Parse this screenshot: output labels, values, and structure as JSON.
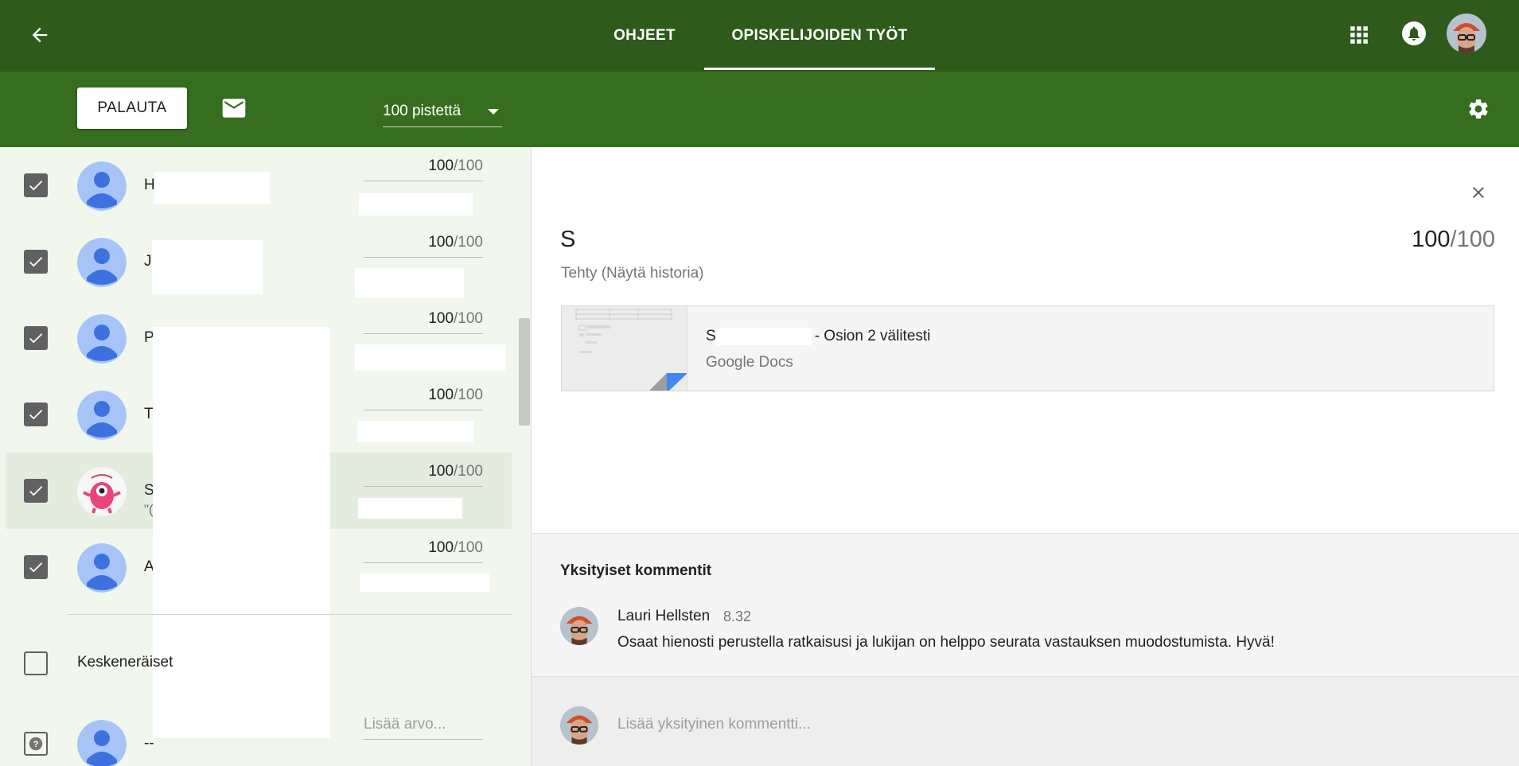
{
  "header": {
    "tabs": [
      {
        "label": "OHJEET",
        "active": false
      },
      {
        "label": "OPISKELIJOIDEN TYÖT",
        "active": true
      }
    ]
  },
  "toolbar": {
    "return_label": "PALAUTA",
    "points_value": "100 pistettä"
  },
  "students": [
    {
      "name": "H",
      "subtitle": "",
      "points": "100",
      "total": "/100",
      "checked": true,
      "avatar": "default"
    },
    {
      "name": "J",
      "subtitle": "",
      "points": "100",
      "total": "/100",
      "checked": true,
      "avatar": "default"
    },
    {
      "name": "P",
      "subtitle": "",
      "points": "100",
      "total": "/100",
      "checked": true,
      "avatar": "default"
    },
    {
      "name": "T",
      "subtitle": "",
      "points": "100",
      "total": "/100",
      "checked": true,
      "avatar": "default"
    },
    {
      "name": "S",
      "subtitle": "\"(",
      "points": "100",
      "total": "/100",
      "checked": true,
      "avatar": "pink-monster",
      "selected": true
    },
    {
      "name": "A",
      "subtitle": "",
      "points": "100",
      "total": "/100",
      "checked": true,
      "avatar": "default"
    }
  ],
  "section": {
    "label": "Keskeneräiset"
  },
  "pending_student": {
    "name": "--",
    "grade_placeholder": "Lisää arvo..."
  },
  "detail": {
    "student_name": "S",
    "points": "100",
    "total": "/100",
    "status": "Tehty (Näytä historia)",
    "attachment": {
      "title_prefix": "S",
      "title_suffix": "- Osion 2 välitesti",
      "type": "Google Docs"
    }
  },
  "comments": {
    "heading": "Yksityiset kommentit",
    "items": [
      {
        "author": "Lauri Hellsten",
        "time": "8.32",
        "text": "Osaat hienosti perustella ratkaisusi ja lukijan on helppo seurata vastauksen muodostumista. Hyvä!"
      }
    ],
    "placeholder": "Lisää yksityinen kommentti..."
  },
  "colors": {
    "topbar": "#2e5a1c",
    "toolbar": "#376d1e",
    "list_bg": "#f1f7ed",
    "avatar_blue": "#a7c4f9"
  }
}
